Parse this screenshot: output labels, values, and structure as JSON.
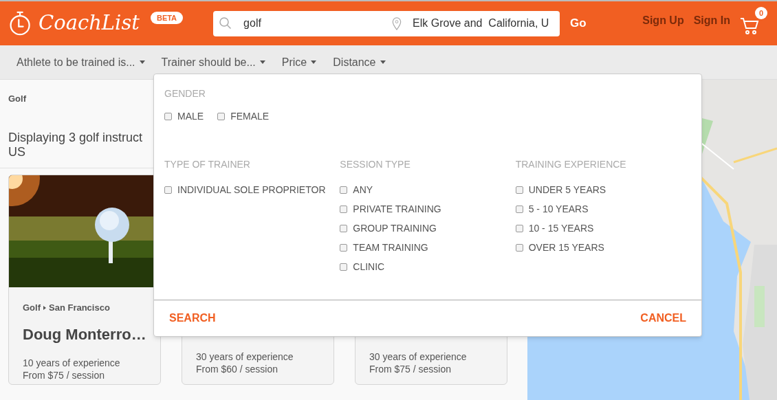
{
  "header": {
    "logo": "CoachList",
    "badge": "BETA",
    "search": {
      "value": "golf"
    },
    "location": {
      "value": "Elk Grove and  California, U"
    },
    "go": "Go",
    "links": [
      "Sign Up",
      "Sign In"
    ],
    "cart_count": "0"
  },
  "filters": [
    "Athlete to be trained is...",
    "Trainer should be...",
    "Price",
    "Distance"
  ],
  "breadcrumb": "Golf",
  "heading": [
    "Displaying 3 golf instruct",
    "US"
  ],
  "cards": [
    {
      "kind": "full",
      "category": "Golf",
      "location": "San Francisco",
      "name": "Doug Monterro…",
      "experience": "10 years of experience",
      "price": "From $75 / session"
    },
    {
      "kind": "covered",
      "experience": "30 years of experience",
      "price": "From $60 / session"
    },
    {
      "kind": "covered",
      "experience": "30 years of experience",
      "price": "From $75 / session"
    }
  ],
  "dropdown": {
    "top_groups": [
      {
        "title": "GENDER",
        "options": [
          {
            "label": "MALE",
            "checked": false
          },
          {
            "label": "FEMALE",
            "checked": false
          }
        ]
      }
    ],
    "groups": [
      {
        "title": "TYPE OF TRAINER",
        "options": [
          {
            "label": "INDIVIDUAL SOLE PROPRIETOR",
            "checked": false
          }
        ]
      },
      {
        "title": "SESSION TYPE",
        "options": [
          {
            "label": "ANY",
            "checked": false
          },
          {
            "label": "PRIVATE TRAINING",
            "checked": false
          },
          {
            "label": "GROUP TRAINING",
            "checked": false
          },
          {
            "label": "TEAM TRAINING",
            "checked": false
          },
          {
            "label": "CLINIC",
            "checked": false
          }
        ]
      },
      {
        "title": "TRAINING EXPERIENCE",
        "options": [
          {
            "label": "UNDER 5 YEARS",
            "checked": false
          },
          {
            "label": "5 - 10 YEARS",
            "checked": false
          },
          {
            "label": "10 - 15 YEARS",
            "checked": false
          },
          {
            "label": "OVER 15 YEARS",
            "checked": false
          }
        ]
      }
    ],
    "search": "SEARCH",
    "cancel": "CANCEL"
  },
  "map": {
    "kind": "picture"
  }
}
